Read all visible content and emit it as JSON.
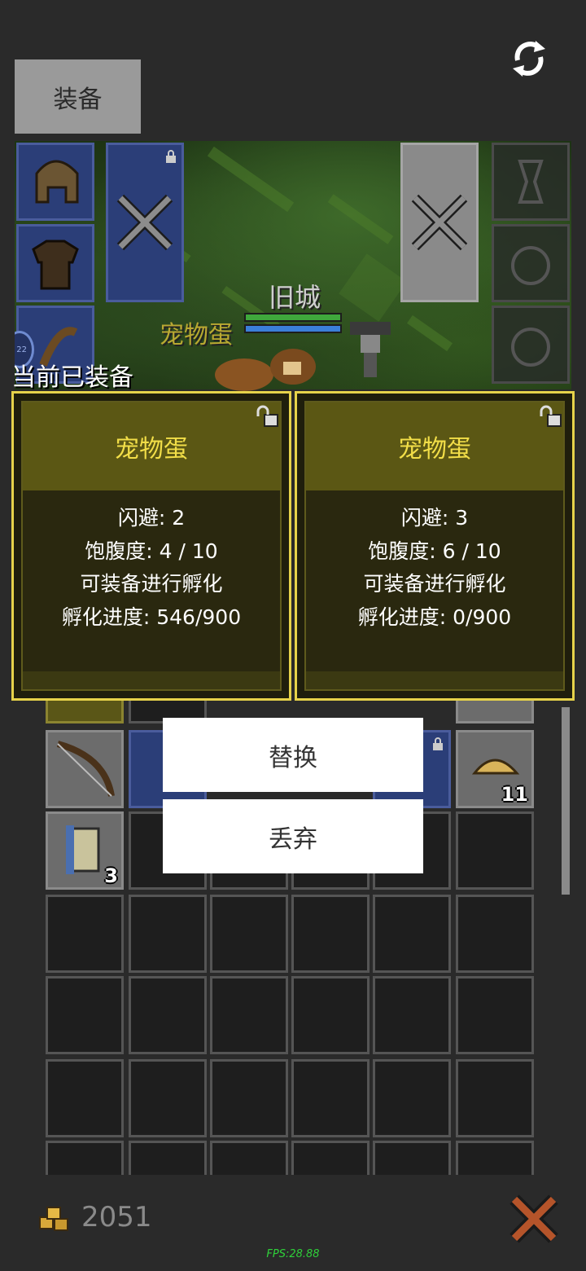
{
  "header": {
    "equip_tab": "装备",
    "refresh_icon": "refresh-icon"
  },
  "scene": {
    "map_name": "旧城",
    "pet_label": "宠物蛋",
    "side_badge": "22"
  },
  "current_equipped_label": "当前已装备",
  "cards": [
    {
      "title": "宠物蛋",
      "dodge": "闪避: 2",
      "satiety": "饱腹度: 4 / 10",
      "note": "可装备进行孵化",
      "progress": "孵化进度: 546/900"
    },
    {
      "title": "宠物蛋",
      "dodge": "闪避: 3",
      "satiety": "饱腹度: 6 / 10",
      "note": "可装备进行孵化",
      "progress": "孵化进度: 0/900"
    }
  ],
  "menu": {
    "replace": "替换",
    "discard": "丢弃"
  },
  "inventory": {
    "bread_count": "11",
    "scroll_count": "3"
  },
  "footer": {
    "gold": "2051",
    "fps": "FPS:28.88"
  },
  "colors": {
    "card_border": "#e6d24a",
    "card_title": "#f2de48",
    "fps_text": "#2fd13a",
    "slot_blue": "#2b3e78"
  }
}
